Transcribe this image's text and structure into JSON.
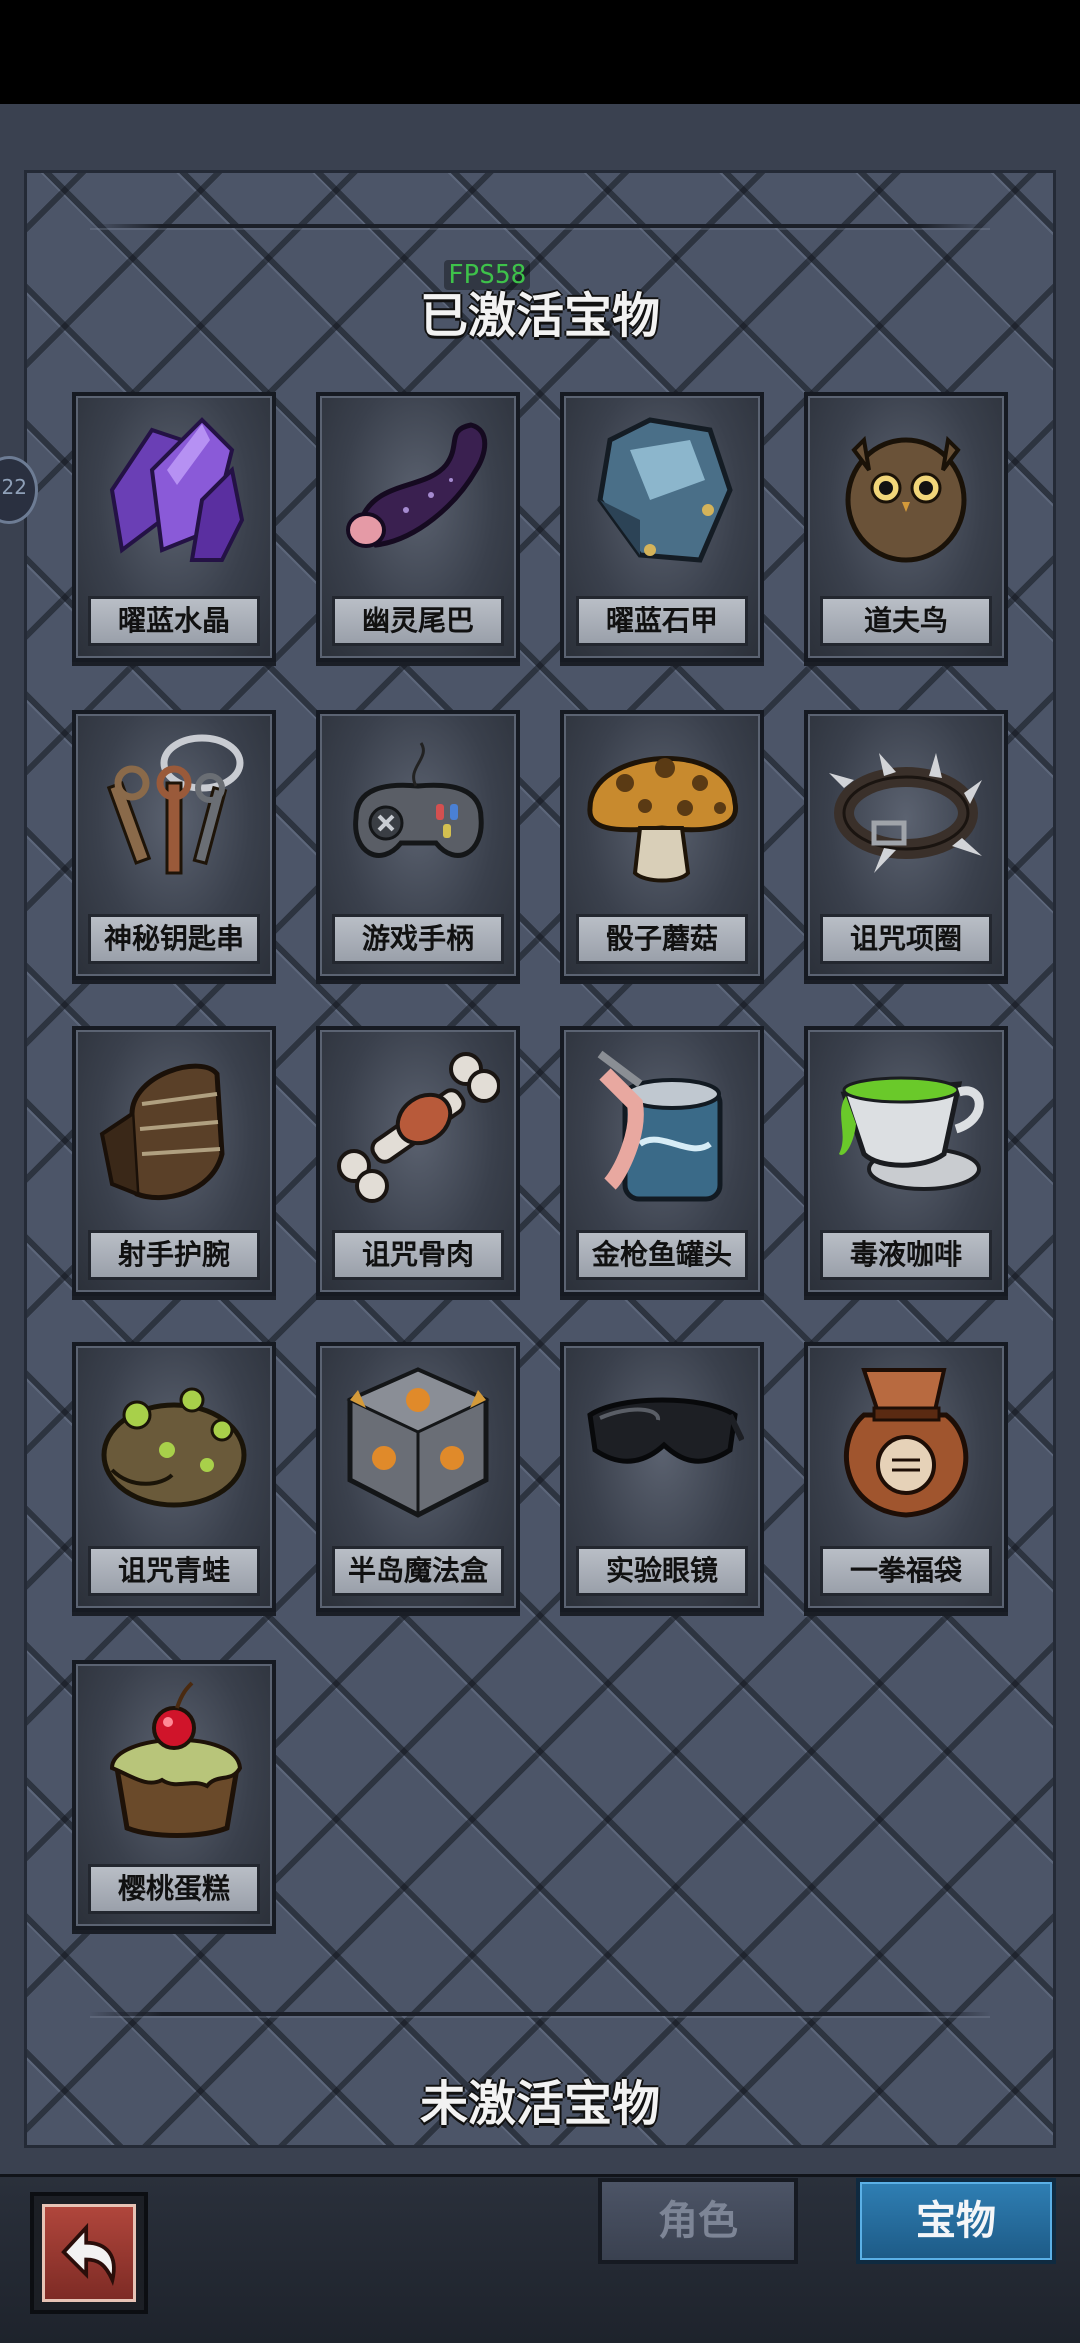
{
  "status": {
    "fps": "FPS58",
    "side_badge": "22"
  },
  "sections": {
    "active_title": "已激活宝物",
    "inactive_title": "未激活宝物"
  },
  "treasures": [
    {
      "name": "曜蓝水晶",
      "icon": "crystal-icon"
    },
    {
      "name": "幽灵尾巴",
      "icon": "tail-icon"
    },
    {
      "name": "曜蓝石甲",
      "icon": "armor-icon"
    },
    {
      "name": "道夫鸟",
      "icon": "owl-icon"
    },
    {
      "name": "神秘钥匙串",
      "icon": "keychain-icon"
    },
    {
      "name": "游戏手柄",
      "icon": "gamepad-icon"
    },
    {
      "name": "骰子蘑菇",
      "icon": "mushroom-icon"
    },
    {
      "name": "诅咒项圈",
      "icon": "spiked-collar-icon"
    },
    {
      "name": "射手护腕",
      "icon": "bracer-icon"
    },
    {
      "name": "诅咒骨肉",
      "icon": "bone-meat-icon"
    },
    {
      "name": "金枪鱼罐头",
      "icon": "tuna-can-icon"
    },
    {
      "name": "毒液咖啡",
      "icon": "poison-coffee-icon"
    },
    {
      "name": "诅咒青蛙",
      "icon": "frog-icon"
    },
    {
      "name": "半岛魔法盒",
      "icon": "magic-cube-icon"
    },
    {
      "name": "实验眼镜",
      "icon": "goggles-icon"
    },
    {
      "name": "一拳福袋",
      "icon": "fist-bag-icon"
    },
    {
      "name": "樱桃蛋糕",
      "icon": "cherry-cake-icon"
    }
  ],
  "bottom_nav": {
    "role_tab": "角色",
    "treasure_tab": "宝物"
  }
}
